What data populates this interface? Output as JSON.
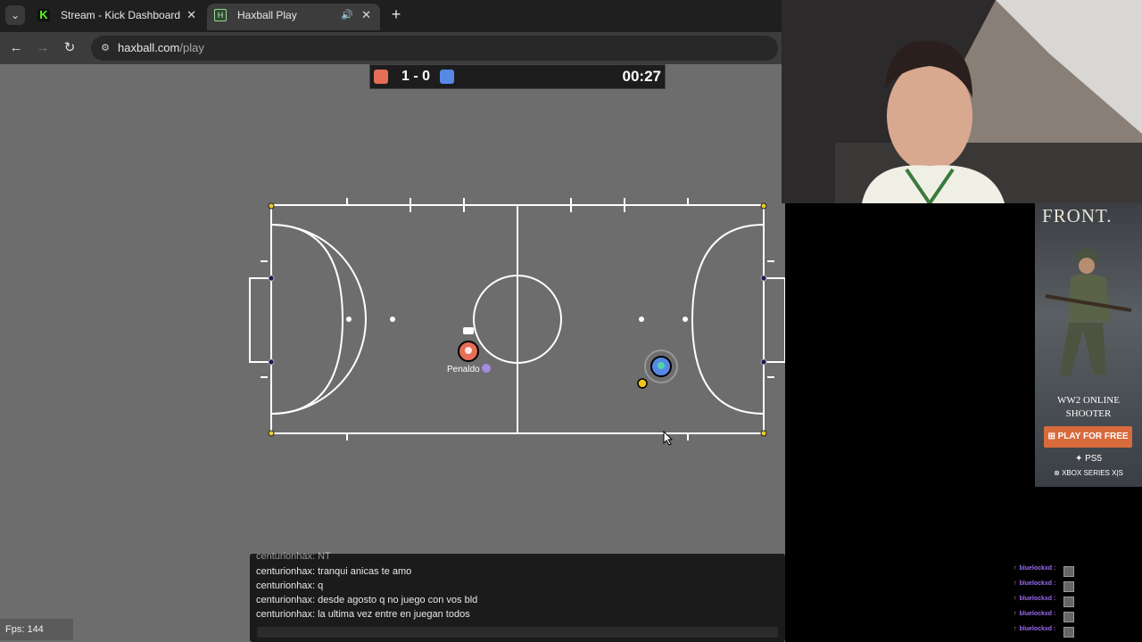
{
  "browser": {
    "tabs": [
      {
        "title": "Stream - Kick Dashboard",
        "favicon": "kick-icon",
        "active": false
      },
      {
        "title": "Haxball Play",
        "favicon": "haxball-icon",
        "active": true
      }
    ],
    "url_host": "haxball.com",
    "url_path": "/play",
    "icons": {
      "back": "←",
      "forward": "→",
      "reload": "↻",
      "site_info": "⚙",
      "new_tab": "+",
      "close": "✕",
      "speaker": "🔊",
      "tab_list": "⌄"
    }
  },
  "game": {
    "score": "1 - 0",
    "timer": "00:27",
    "colors": {
      "red_team": "#e56e56",
      "blue_team": "#5689e5",
      "ball": "#f2c41a",
      "field": "#6d6d6d",
      "lines": "#ffffff"
    },
    "player_name": "Penaldo",
    "chat": [
      "centurionhax: NT",
      "centurionhax: tranqui anicas te amo",
      "centurionhax: q",
      "centurionhax: desde agosto q no juego con vos bld",
      "centurionhax: la ultima vez entre en juegan todos"
    ],
    "fps": "Fps: 144"
  },
  "ad": {
    "title": "FRONT.",
    "tagline_1": "WW2 ONLINE",
    "tagline_2": "SHOOTER",
    "cta": "PLAY FOR FREE",
    "platform_1": "PS5",
    "platform_2": "XBOX SERIES X|S"
  },
  "viewers": [
    {
      "name": "bluelockxd :"
    },
    {
      "name": "bluelockxd :"
    },
    {
      "name": "bluelockxd :"
    },
    {
      "name": "bluelockxd :"
    },
    {
      "name": "bluelockxd :"
    }
  ]
}
